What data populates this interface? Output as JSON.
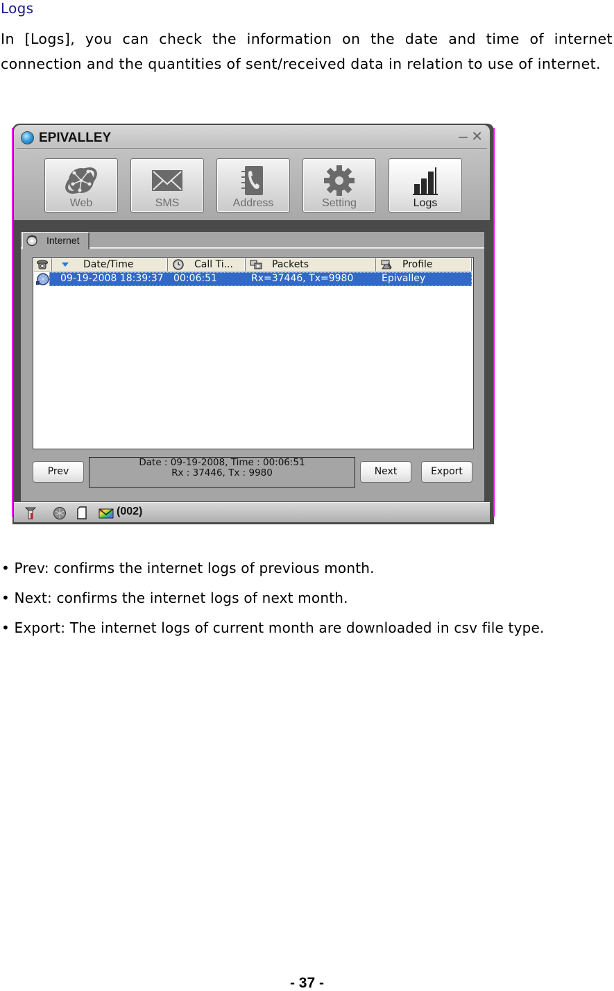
{
  "document": {
    "section_title": "Logs",
    "intro": "In [Logs], you can check the information on the date and time of internet connection and the quantities of sent/received data in relation to use of internet.",
    "bullets": [
      "• Prev: confirms the internet logs of previous month.",
      "• Next: confirms the internet logs of next month.",
      "• Export: The internet logs of current month are downloaded in csv file type."
    ],
    "page_number": "- 37 -"
  },
  "app": {
    "title": "EPIVALLEY",
    "window_controls": {
      "minimize": "−",
      "close": "✕"
    },
    "nav": [
      {
        "label": "Web",
        "icon": "globe-network-icon",
        "active": false
      },
      {
        "label": "SMS",
        "icon": "envelope-icon",
        "active": false
      },
      {
        "label": "Address",
        "icon": "address-book-phone-icon",
        "active": false
      },
      {
        "label": "Setting",
        "icon": "gear-icon",
        "active": false
      },
      {
        "label": "Logs",
        "icon": "signal-bars-icon",
        "active": true
      }
    ],
    "tabs": [
      {
        "label": "Internet",
        "icon": "internet-globe-icon",
        "active": true
      }
    ],
    "list": {
      "columns": [
        {
          "label": "",
          "icon": "phone-icon"
        },
        {
          "label": "Date/Time",
          "icon": "sort-descending-icon"
        },
        {
          "label": "Call Ti...",
          "icon": "clock-icon"
        },
        {
          "label": "Packets",
          "icon": "packets-icon"
        },
        {
          "label": "Profile",
          "icon": "profile-icon"
        }
      ],
      "rows": [
        {
          "date_time": "09-19-2008 18:39:37",
          "call_time": "00:06:51",
          "packets": "Rx=37446, Tx=9980",
          "profile": "Epivalley",
          "selected": true
        }
      ]
    },
    "buttons": {
      "prev": "Prev",
      "next": "Next",
      "export": "Export"
    },
    "summary": {
      "line1": "Date : 09-19-2008, Time : 00:06:51",
      "line2": "Rx : 37446, Tx : 9980"
    },
    "statusbar": {
      "message_count": "(002)"
    },
    "colors": {
      "selection": "#316ac5",
      "frame_marker": "#ff00ff",
      "header_bg": "#ece9d8"
    }
  }
}
